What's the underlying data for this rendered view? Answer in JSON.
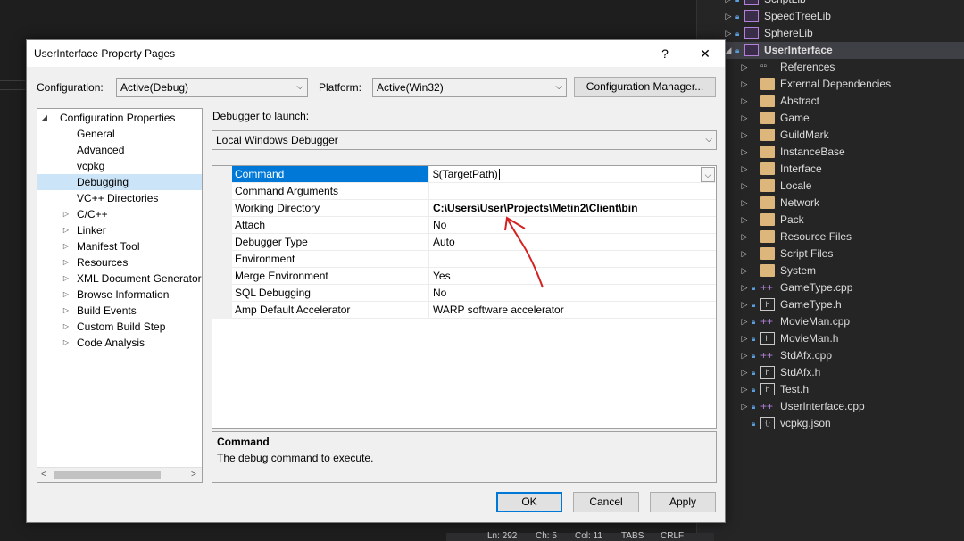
{
  "ide": {
    "status": {
      "line": "Ln: 292",
      "char": "Ch: 5",
      "col": "Col: 11",
      "tabs": "TABS",
      "crlf": "CRLF"
    }
  },
  "solution_explorer": {
    "items": [
      {
        "label": "ScriptLib",
        "kind": "project"
      },
      {
        "label": "SpeedTreeLib",
        "kind": "project"
      },
      {
        "label": "SphereLib",
        "kind": "project"
      },
      {
        "label": "UserInterface",
        "kind": "project"
      },
      {
        "label": "References",
        "kind": "ref"
      },
      {
        "label": "External Dependencies",
        "kind": "folder"
      },
      {
        "label": "Abstract",
        "kind": "folder"
      },
      {
        "label": "Game",
        "kind": "folder"
      },
      {
        "label": "GuildMark",
        "kind": "folder"
      },
      {
        "label": "InstanceBase",
        "kind": "folder"
      },
      {
        "label": "Interface",
        "kind": "folder"
      },
      {
        "label": "Locale",
        "kind": "folder"
      },
      {
        "label": "Network",
        "kind": "folder"
      },
      {
        "label": "Pack",
        "kind": "folder"
      },
      {
        "label": "Resource Files",
        "kind": "folder"
      },
      {
        "label": "Script Files",
        "kind": "folder"
      },
      {
        "label": "System",
        "kind": "folder"
      },
      {
        "label": "GameType.cpp",
        "kind": "cpp"
      },
      {
        "label": "GameType.h",
        "kind": "h"
      },
      {
        "label": "MovieMan.cpp",
        "kind": "cpp"
      },
      {
        "label": "MovieMan.h",
        "kind": "h"
      },
      {
        "label": "StdAfx.cpp",
        "kind": "cpp"
      },
      {
        "label": "StdAfx.h",
        "kind": "h"
      },
      {
        "label": "Test.h",
        "kind": "h"
      },
      {
        "label": "UserInterface.cpp",
        "kind": "cpp"
      },
      {
        "label": "vcpkg.json",
        "kind": "json"
      }
    ],
    "h_icon_text": "h",
    "json_icon_text": "{}",
    "cpp_icon_text": "++",
    "ref_icon_text": "▫▫"
  },
  "dialog": {
    "title": "UserInterface Property Pages",
    "help_label": "?",
    "close_label": "✕",
    "configuration_label": "Configuration:",
    "configuration_value": "Active(Debug)",
    "platform_label": "Platform:",
    "platform_value": "Active(Win32)",
    "config_manager_label": "Configuration Manager...",
    "tree": {
      "root": "Configuration Properties",
      "items": [
        {
          "label": "General",
          "expandable": false
        },
        {
          "label": "Advanced",
          "expandable": false
        },
        {
          "label": "vcpkg",
          "expandable": false
        },
        {
          "label": "Debugging",
          "expandable": false,
          "selected": true
        },
        {
          "label": "VC++ Directories",
          "expandable": false
        },
        {
          "label": "C/C++",
          "expandable": true
        },
        {
          "label": "Linker",
          "expandable": true
        },
        {
          "label": "Manifest Tool",
          "expandable": true
        },
        {
          "label": "Resources",
          "expandable": true
        },
        {
          "label": "XML Document Generator",
          "expandable": true
        },
        {
          "label": "Browse Information",
          "expandable": true
        },
        {
          "label": "Build Events",
          "expandable": true
        },
        {
          "label": "Custom Build Step",
          "expandable": true
        },
        {
          "label": "Code Analysis",
          "expandable": true
        }
      ]
    },
    "debugger_label": "Debugger to launch:",
    "debugger_value": "Local Windows Debugger",
    "properties": [
      {
        "name": "Command",
        "value": "$(TargetPath)",
        "selected": true
      },
      {
        "name": "Command Arguments",
        "value": ""
      },
      {
        "name": "Working Directory",
        "value": "C:\\Users\\User\\Projects\\Metin2\\Client\\bin",
        "bold": true
      },
      {
        "name": "Attach",
        "value": "No"
      },
      {
        "name": "Debugger Type",
        "value": "Auto"
      },
      {
        "name": "Environment",
        "value": ""
      },
      {
        "name": "Merge Environment",
        "value": "Yes"
      },
      {
        "name": "SQL Debugging",
        "value": "No"
      },
      {
        "name": "Amp Default Accelerator",
        "value": "WARP software accelerator"
      }
    ],
    "description": {
      "title": "Command",
      "text": "The debug command to execute."
    },
    "buttons": {
      "ok": "OK",
      "cancel": "Cancel",
      "apply": "Apply"
    },
    "colors": {
      "selection": "#0078d7",
      "annotation": "#d42020"
    }
  }
}
